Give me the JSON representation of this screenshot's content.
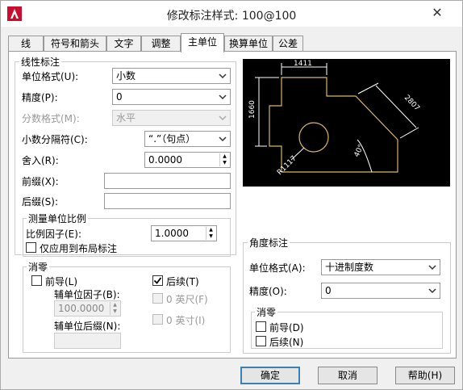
{
  "window": {
    "title": "修改标注样式: 100@100",
    "close_glyph": "✕",
    "app_icon": "autocad-a-icon"
  },
  "tabs": [
    {
      "label": "线"
    },
    {
      "label": "符号和箭头"
    },
    {
      "label": "文字"
    },
    {
      "label": "调整"
    },
    {
      "label": "主单位"
    },
    {
      "label": "换算单位"
    },
    {
      "label": "公差"
    }
  ],
  "linear": {
    "title": "线性标注",
    "unit_format_label": "单位格式(U):",
    "unit_format_value": "小数",
    "precision_label": "精度(P):",
    "precision_value": "0",
    "fraction_label": "分数格式(M):",
    "fraction_value": "水平",
    "decimal_sep_label": "小数分隔符(C):",
    "decimal_sep_value": "“.”（句点）",
    "round_label": "舍入(R):",
    "round_value": "0.0000",
    "prefix_label": "前缀(X):",
    "prefix_value": "",
    "suffix_label": "后缀(S):",
    "suffix_value": ""
  },
  "measure": {
    "title": "测量单位比例",
    "scale_label": "比例因子(E):",
    "scale_value": "1.0000",
    "layout_only_label": "仅应用到布局标注"
  },
  "zero": {
    "title": "消零",
    "leading_label": "前导(L)",
    "sub_factor_label": "辅单位因子(B):",
    "sub_factor_value": "100.0000",
    "sub_suffix_label": "辅单位后缀(N):",
    "sub_suffix_value": "",
    "trailing_label": "后续(T)",
    "feet_label": "0 英尺(F)",
    "inch_label": "0 英寸(I)"
  },
  "angular": {
    "title": "角度标注",
    "unit_format_label": "单位格式(A):",
    "unit_format_value": "十进制度数",
    "precision_label": "精度(O):",
    "precision_value": "0",
    "zero_title": "消零",
    "leading_label": "前导(D)",
    "trailing_label": "后续(N)"
  },
  "preview": {
    "dim_top": "1411",
    "dim_left": "1660",
    "dim_diag": "2807",
    "dim_angle": "40°",
    "dim_radius": "R1117",
    "line_color": "#ffffff",
    "geometry_color": "#d8b66a"
  },
  "buttons": {
    "ok": "确定",
    "cancel": "取消",
    "help": "帮助(H)"
  },
  "colors": {
    "accent": "#3c7fb1",
    "icon_red": "#c8102e"
  }
}
